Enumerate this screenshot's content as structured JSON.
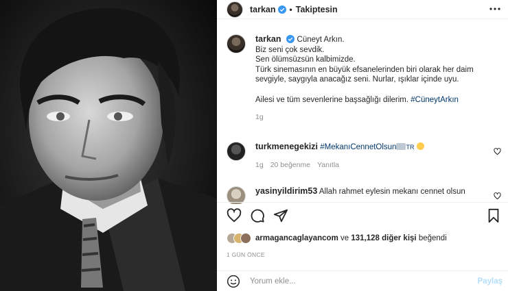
{
  "post": {
    "author": "tarkan",
    "follow_status": "Takiptesin",
    "separator": "•",
    "more_icon": "more-horizontal-icon"
  },
  "caption": {
    "author": "tarkan",
    "lines": [
      "Cüneyt Arkın.",
      "Biz seni çok sevdik.",
      "Sen ölümsüzsün kalbimizde.",
      "Türk sinemasının en büyük efsanelerinden biri olarak her daim",
      "sevgiyle, saygıyla anacağız seni. Nurlar, ışıklar içinde uyu."
    ],
    "closing_text": "Ailesi ve tüm sevenlerine başsağlığı dilerim.",
    "hashtag": "#CüneytArkın",
    "age": "1g"
  },
  "comments": [
    {
      "username": "turkmenegekizi",
      "hashtag": "#MekanıCennetOlsun",
      "trail": "TR",
      "age": "1g",
      "likes": "20 beğenme",
      "reply": "Yanıtla"
    },
    {
      "username": "yasinyildirim53",
      "text": "Allah rahmet eylesin mekanı cennet olsun"
    }
  ],
  "likes": {
    "liker": "armagancaglayancom",
    "connector": " ve ",
    "count_text": "131,128 diğer kişi",
    "suffix": " beğendi"
  },
  "date": "1 GÜN ÖNCE",
  "comment_box": {
    "placeholder": "Yorum ekle...",
    "post_label": "Paylaş"
  },
  "colors": {
    "hashtag": "#00376b",
    "verified": "#3897f0",
    "post_disabled": "#b2dffc"
  }
}
